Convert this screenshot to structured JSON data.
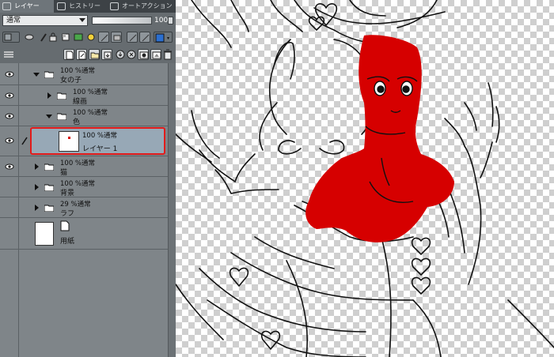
{
  "tabs": {
    "layer": "レイヤー",
    "history": "ヒストリー",
    "auto_action": "オートアクション"
  },
  "blend": {
    "mode": "通常",
    "opacity_value": "100"
  },
  "layers": [
    {
      "percent": "100 %通常",
      "name": "女の子",
      "type": "folder",
      "expanded": true
    },
    {
      "percent": "100 %通常",
      "name": "線画",
      "type": "folder",
      "expanded": false
    },
    {
      "percent": "100 %通常",
      "name": "色",
      "type": "folder",
      "expanded": true
    },
    {
      "percent": "100 %通常",
      "name": "レイヤー 1",
      "type": "raster",
      "selected": true
    },
    {
      "percent": "100 %通常",
      "name": "猫",
      "type": "folder",
      "expanded": false
    },
    {
      "percent": "100 %通常",
      "name": "背景",
      "type": "folder",
      "expanded": false
    },
    {
      "percent": "29 %通常",
      "name": "ラフ",
      "type": "folder",
      "expanded": false
    },
    {
      "name": "用紙",
      "type": "paper"
    }
  ],
  "colors": {
    "selection_highlight": "#e21b1b",
    "color_fill": "#d60000",
    "panel_bg": "#7f8589"
  }
}
